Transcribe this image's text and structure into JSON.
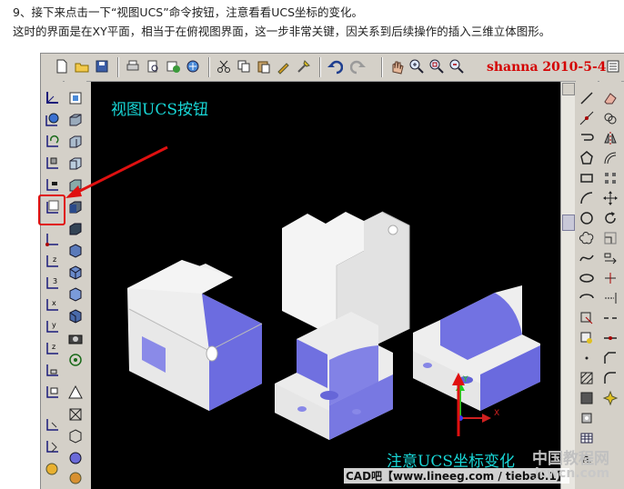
{
  "captions": {
    "line1": "9、接下来点击一下“视图UCS”命令按钮，注意看看UCS坐标的变化。",
    "line2": "这时的界面是在XY平面，相当于在俯视图界面，这一步非常关键，因关系到后续操作的插入三维立体图形。"
  },
  "toolbar": {
    "brand_text": "shanna 2010-5-4",
    "icons": [
      "new-file-icon",
      "open-folder-icon",
      "save-icon",
      "print-icon",
      "print-preview-icon",
      "publish-icon",
      "cut-icon",
      "copy-icon",
      "paste-icon",
      "match-properties-icon",
      "block-editor-icon",
      "undo-icon",
      "redo-icon",
      "pan-icon",
      "zoom-realtime-icon",
      "zoom-window-icon",
      "zoom-previous-icon"
    ]
  },
  "annotations": {
    "view_ucs_label": "视图UCS按钮",
    "note_label": "注意UCS坐标变化"
  },
  "viewport": {
    "ucs_axes": [
      "X",
      "Y",
      "Z"
    ]
  },
  "colors": {
    "annotation_text": "#18d6d6",
    "arrow": "#e01010",
    "brand": "#d40000",
    "viewport_bg": "#000000",
    "model_face": "#f0f0f0",
    "model_shade": "#7070e0"
  },
  "watermarks": {
    "site": "CAD吧【www.lineeg.com / tieba0.1】",
    "cn": "中国教程网",
    "logo": "jcwcn.com"
  }
}
